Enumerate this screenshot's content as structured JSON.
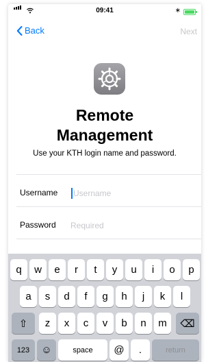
{
  "status_bar": {
    "time": "09:41",
    "bluetooth": "∗"
  },
  "nav": {
    "back_label": "Back",
    "next_label": "Next"
  },
  "app_icon": "settings-gear-icon",
  "header": {
    "title_line1": "Remote",
    "title_line2": "Management",
    "subtitle": "Use your KTH login name and password."
  },
  "form": {
    "username_label": "Username",
    "username_placeholder": "Username",
    "password_label": "Password",
    "password_placeholder": "Required"
  },
  "keyboard": {
    "row1": [
      "q",
      "w",
      "e",
      "r",
      "t",
      "y",
      "u",
      "i",
      "o",
      "p"
    ],
    "row2": [
      "a",
      "s",
      "d",
      "f",
      "g",
      "h",
      "j",
      "k",
      "l"
    ],
    "row3": [
      "z",
      "x",
      "c",
      "v",
      "b",
      "n",
      "m"
    ],
    "numbers_key": "123",
    "emoji_key": "☺",
    "space_key": "space",
    "at_key": "@",
    "dot_key": ".",
    "return_key": "return",
    "shift_key": "⇧",
    "delete_key": "⌫"
  },
  "colors": {
    "accent": "#007aff",
    "battery": "#4cd964",
    "keyboard_bg": "#d1d3d9"
  }
}
